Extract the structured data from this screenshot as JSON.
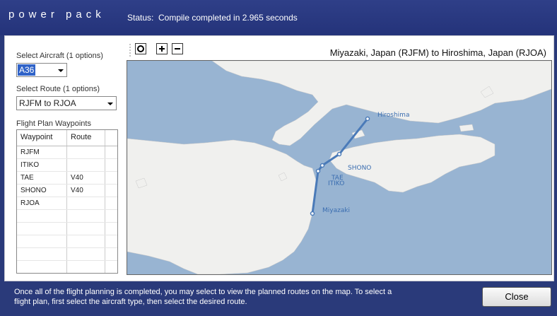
{
  "app": {
    "logo": "power pack"
  },
  "status": {
    "label": "Status:",
    "text": "Compile completed in 2.965 seconds"
  },
  "aircraft": {
    "label": "Select Aircraft (1 options)",
    "value": "A36"
  },
  "route": {
    "label": "Select Route (1 options)",
    "value": "RJFM to RJOA"
  },
  "waypoints": {
    "label": "Flight Plan Waypoints",
    "headers": [
      "Waypoint",
      "Route"
    ],
    "rows": [
      {
        "waypoint": "RJFM",
        "route": ""
      },
      {
        "waypoint": "ITIKO",
        "route": ""
      },
      {
        "waypoint": "TAE",
        "route": "V40"
      },
      {
        "waypoint": "SHONO",
        "route": "V40"
      },
      {
        "waypoint": "RJOA",
        "route": ""
      }
    ]
  },
  "toolbar": {
    "fit_icon": "fit-view-icon",
    "zoom_in_icon": "zoom-in-icon",
    "zoom_out_icon": "zoom-out-icon"
  },
  "map": {
    "title": "Miyazaki, Japan (RJFM) to Hiroshima, Japan (RJOA)",
    "labels": {
      "hiroshima": "Hiroshima",
      "shono": "SHONO",
      "tae": "TAE",
      "itiko": "ITIKO",
      "miyazaki": "Miyazaki"
    },
    "water_color": "#98b4d2",
    "land_color": "#f0f0ee",
    "route_color": "#4a7ab8"
  },
  "footer": {
    "message": "Once all of the flight planning is completed, you may select to view the planned routes on the map.  To select a flight plan, first select the aircraft type, then select the desired route.",
    "close_label": "Close"
  }
}
